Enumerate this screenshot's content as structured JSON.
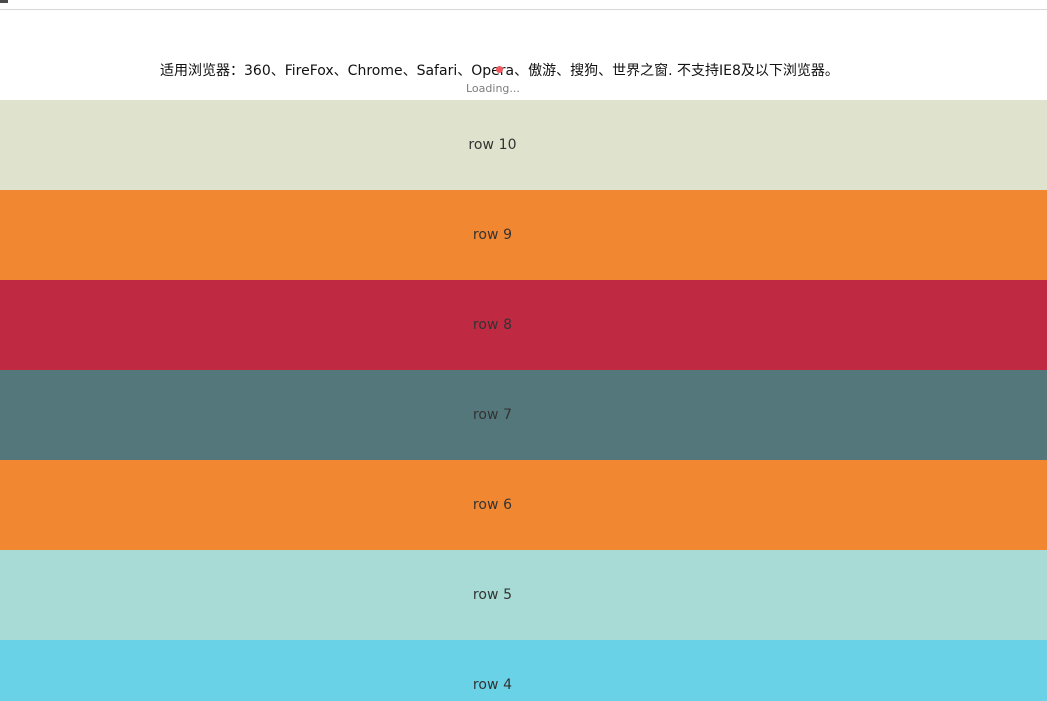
{
  "header": {
    "notice": "适用浏览器：360、FireFox、Chrome、Safari、Opera、傲游、搜狗、世界之窗. 不支持IE8及以下浏览器。",
    "loading": "Loading..."
  },
  "rows": [
    {
      "label": "row 10",
      "color": "#dfe2cc"
    },
    {
      "label": "row 9",
      "color": "#f28732"
    },
    {
      "label": "row 8",
      "color": "#c02942"
    },
    {
      "label": "row 7",
      "color": "#53777a"
    },
    {
      "label": "row 6",
      "color": "#f28732"
    },
    {
      "label": "row 5",
      "color": "#a8dbd5"
    },
    {
      "label": "row 4",
      "color": "#69d2e7"
    }
  ],
  "accent": {
    "loader": "#f0595f"
  }
}
